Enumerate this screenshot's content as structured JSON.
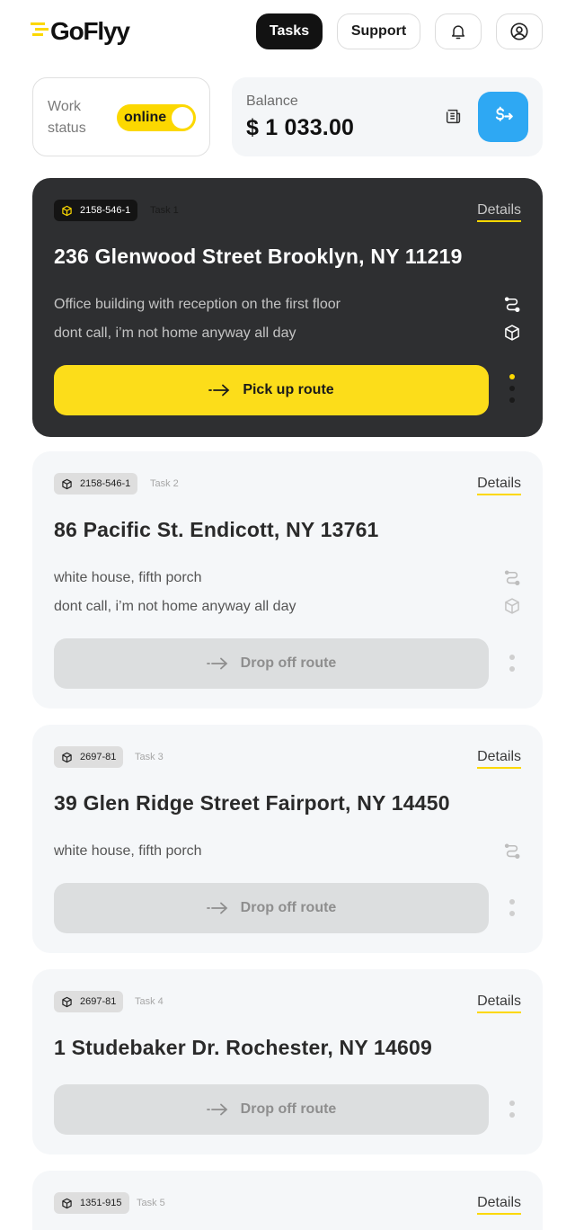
{
  "brand": {
    "name": "GoFlyy",
    "accent": "#fcd800"
  },
  "nav": {
    "tasks": "Tasks",
    "support": "Support",
    "bell_icon": "bell-icon",
    "profile_icon": "user-circle-icon"
  },
  "work_status": {
    "label": "Work status",
    "toggle": "online",
    "on": true
  },
  "balance": {
    "label": "Balance",
    "amount": "$ 1 033.00"
  },
  "tasks": [
    {
      "code": "2158-546-1",
      "task": "Task 1",
      "details": "Details",
      "address": "236 Glenwood Street Brooklyn, NY 11219",
      "notes": [
        "Office building with reception on the first floor",
        "dont call, i’m not home anyway all day"
      ],
      "action": "Pick up route",
      "active": true
    },
    {
      "code": "2158-546-1",
      "task": "Task 2",
      "details": "Details",
      "address": "86 Pacific St. Endicott, NY 13761",
      "notes": [
        "white house, fifth porch",
        "dont call, i’m not home anyway all day"
      ],
      "action": "Drop off route",
      "active": false
    },
    {
      "code": "2697-81",
      "task": "Task 3",
      "details": "Details",
      "address": "39 Glen Ridge Street Fairport, NY 14450",
      "notes": [
        "white house, fifth porch"
      ],
      "action": "Drop off route",
      "active": false
    },
    {
      "code": "2697-81",
      "task": "Task 4",
      "details": "Details",
      "address": "1 Studebaker Dr. Rochester, NY 14609",
      "notes": [],
      "action": "Drop off route",
      "active": false
    },
    {
      "code": "1351-915",
      "task": "Task 5",
      "details": "Details",
      "address": "",
      "notes": [],
      "action": "",
      "active": false
    }
  ]
}
